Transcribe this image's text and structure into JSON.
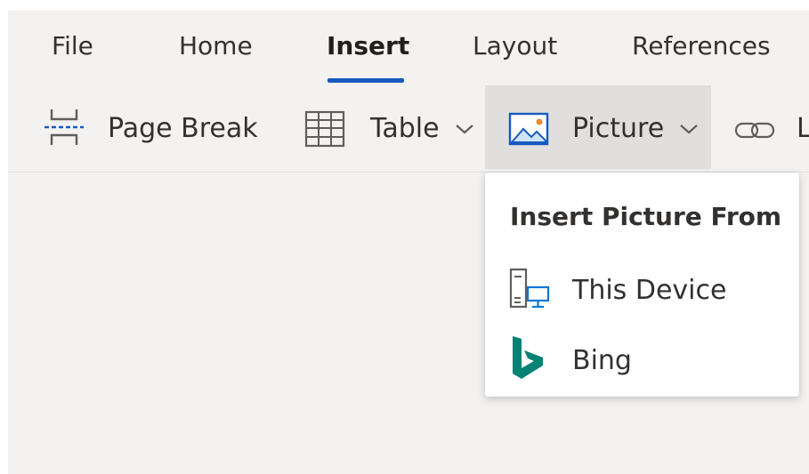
{
  "tabs": [
    {
      "label": "File"
    },
    {
      "label": "Home"
    },
    {
      "label": "Insert"
    },
    {
      "label": "Layout"
    },
    {
      "label": "References"
    }
  ],
  "active_tab": "Insert",
  "commands": {
    "page_break": {
      "label": "Page Break",
      "icon": "page-break-icon"
    },
    "table": {
      "label": "Table",
      "icon": "table-icon"
    },
    "picture": {
      "label": "Picture",
      "icon": "picture-icon"
    },
    "link": {
      "label": "L",
      "icon": "link-icon"
    }
  },
  "picture_menu": {
    "header": "Insert Picture From",
    "items": [
      {
        "label": "This Device",
        "icon": "device-icon"
      },
      {
        "label": "Bing",
        "icon": "bing-icon"
      }
    ]
  },
  "colors": {
    "accent": "#185abd",
    "ribbon_bg": "#f3f2f1",
    "pressed_bg": "#e1dfdd",
    "bing": "#008373",
    "device_screen": "#0078d4"
  }
}
